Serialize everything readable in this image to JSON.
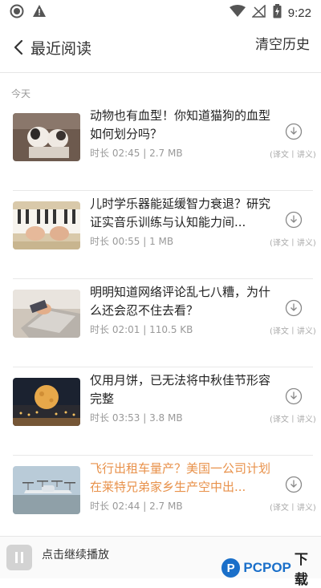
{
  "status_bar": {
    "time": "9:22",
    "icons": [
      "record-icon",
      "warning-icon",
      "wifi-icon",
      "no-signal-icon",
      "battery-charging-icon"
    ]
  },
  "header": {
    "back_icon": "chevron-left-icon",
    "title": "最近阅读",
    "clear_label": "清空历史"
  },
  "section_label": "今天",
  "items": [
    {
      "title": "动物也有血型！你知道猫狗的血型如何划分吗？",
      "duration": "时长 02:45",
      "size": "2.7 MB",
      "download_label": "(译文丨讲义)",
      "highlight": false
    },
    {
      "title": "儿时学乐器能延缓智力衰退？研究证实音乐训练与认知能力间...",
      "duration": "时长 00:55",
      "size": "1 MB",
      "download_label": "(译文丨讲义)",
      "highlight": false
    },
    {
      "title": "明明知道网络评论乱七八糟，为什么还会忍不住去看？",
      "duration": "时长 02:01",
      "size": "110.5 KB",
      "download_label": "(译文丨讲义)",
      "highlight": false
    },
    {
      "title": "仅用月饼，已无法将中秋佳节形容完整",
      "duration": "时长 03:53",
      "size": "3.8 MB",
      "download_label": "(译文丨讲义)",
      "highlight": false
    },
    {
      "title": "飞行出租车量产？美国一公司计划在莱特兄弟家乡生产空中出...",
      "duration": "时长 02:44",
      "size": "2.7 MB",
      "download_label": "(译文丨讲义)",
      "highlight": true
    }
  ],
  "player": {
    "pause_icon": "pause-icon",
    "text": "点击继续播放"
  },
  "watermark": {
    "brand": "PCPOP",
    "suffix": "下载"
  },
  "colors": {
    "highlight_title": "#e8914a",
    "meta_text": "#999999",
    "logo_blue": "#1a6fc9"
  }
}
